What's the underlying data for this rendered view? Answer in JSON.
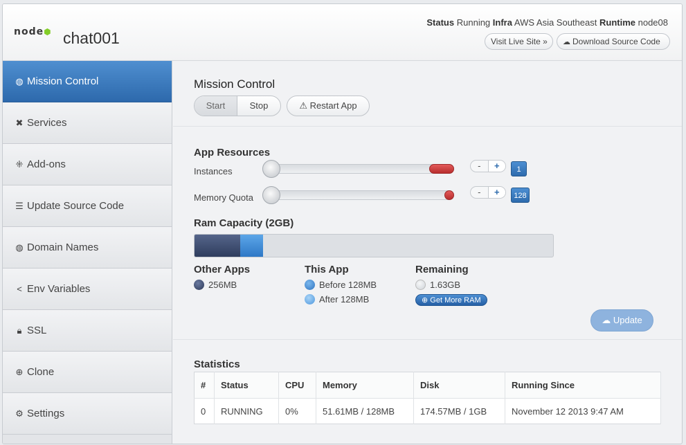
{
  "header": {
    "logo_text": "node",
    "app_name": "chat001",
    "status_label": "Status",
    "status_value": "Running",
    "infra_label": "Infra",
    "infra_value": "AWS Asia Southeast",
    "runtime_label": "Runtime",
    "runtime_value": "node08",
    "visit_label": "Visit Live Site »",
    "download_label": "Download Source Code"
  },
  "sidebar": {
    "items": [
      {
        "label": "Mission Control",
        "icon": "dashboard-icon",
        "glyph": "◍",
        "active": true
      },
      {
        "label": "Services",
        "icon": "tools-icon",
        "glyph": "✖"
      },
      {
        "label": "Add-ons",
        "icon": "plug-icon",
        "glyph": "⁜"
      },
      {
        "label": "Update Source Code",
        "icon": "list-icon",
        "glyph": "☰"
      },
      {
        "label": "Domain Names",
        "icon": "globe-icon",
        "glyph": "◍"
      },
      {
        "label": "Env Variables",
        "icon": "share-icon",
        "glyph": "<"
      },
      {
        "label": "SSL",
        "icon": "lock-icon",
        "glyph": "🔒︎"
      },
      {
        "label": "Clone",
        "icon": "plus-circle-icon",
        "glyph": "⊕"
      },
      {
        "label": "Settings",
        "icon": "gear-icon",
        "glyph": "⚙"
      }
    ]
  },
  "mission": {
    "title": "Mission Control",
    "start_label": "Start",
    "stop_label": "Stop",
    "restart_label": "Restart App"
  },
  "resources": {
    "title": "App Resources",
    "instances_label": "Instances",
    "instances_value": "1",
    "memory_label": "Memory Quota",
    "memory_value": "128",
    "minus": "-",
    "plus": "+"
  },
  "ram": {
    "title": "Ram Capacity (2GB)",
    "other_fraction": 0.125,
    "app_fraction": 0.0625,
    "other_heading": "Other Apps",
    "other_value": "256MB",
    "app_heading": "This App",
    "before_value": "Before 128MB",
    "after_value": "After 128MB",
    "remaining_heading": "Remaining",
    "remaining_value": "1.63GB",
    "get_more_label": "Get More RAM",
    "update_label": "Update"
  },
  "statistics": {
    "title": "Statistics",
    "columns": [
      "#",
      "Status",
      "CPU",
      "Memory",
      "Disk",
      "Running Since"
    ],
    "rows": [
      [
        "0",
        "RUNNING",
        "0%",
        "51.61MB / 128MB",
        "174.57MB / 1GB",
        "November 12 2013 9:47 AM"
      ]
    ]
  },
  "colors": {
    "accent": "#2e6bad",
    "slider_fill": "#c23a3a",
    "other_apps": "#3a4868",
    "this_app": "#3a86d4"
  }
}
